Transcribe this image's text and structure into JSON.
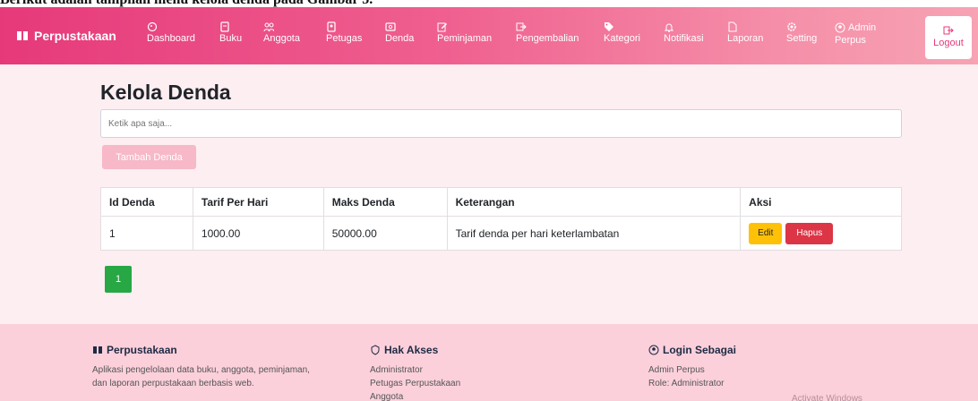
{
  "caption_fragment": "Berikut adalah tampilan menu kelola denda pada Gambar 5.",
  "brand": "Perpustakaan",
  "nav": [
    {
      "label": "Dashboard",
      "icon": "palette-icon"
    },
    {
      "label": "Buku",
      "icon": "book-icon"
    },
    {
      "label": "Anggota",
      "icon": "people-icon"
    },
    {
      "label": "Petugas",
      "icon": "person-badge-icon"
    },
    {
      "label": "Denda",
      "icon": "cash-icon"
    },
    {
      "label": "Peminjaman",
      "icon": "pencil-square-icon"
    },
    {
      "label": "Pengembalian",
      "icon": "box-arrow-right-icon"
    },
    {
      "label": "Kategori",
      "icon": "tag-icon"
    },
    {
      "label": "Notifikasi",
      "icon": "bell-icon"
    },
    {
      "label": "Laporan",
      "icon": "file-icon"
    },
    {
      "label": "Setting",
      "icon": "gear-icon"
    }
  ],
  "admin": {
    "line1": "Admin",
    "line2": "Perpus",
    "icon": "person-circle-icon"
  },
  "logout": "Logout",
  "page": {
    "title": "Kelola Denda",
    "search_placeholder": "Ketik apa saja...",
    "add_button": "Tambah Denda"
  },
  "table": {
    "headers": [
      "Id Denda",
      "Tarif Per Hari",
      "Maks Denda",
      "Keterangan",
      "Aksi"
    ],
    "rows": [
      {
        "id": "1",
        "tarif": "1000.00",
        "maks": "50000.00",
        "keterangan": "Tarif denda per hari keterlambatan",
        "edit": "Edit",
        "hapus": "Hapus"
      }
    ]
  },
  "pagination": {
    "current": "1"
  },
  "footer": {
    "about": {
      "title": "Perpustakaan",
      "text1": "Aplikasi pengelolaan data buku, anggota, peminjaman,",
      "text2": "dan laporan perpustakaan berbasis web."
    },
    "access": {
      "title": "Hak Akses",
      "items": [
        "Administrator",
        "Petugas Perpustakaan",
        "Anggota"
      ]
    },
    "login": {
      "title": "Login Sebagai",
      "user": "Admin Perpus",
      "role": "Role: Administrator"
    }
  },
  "watermark": "Activate Windows",
  "colors": {
    "primary": "#e6397a",
    "warning": "#ffc107",
    "danger": "#dc3545",
    "success": "#28a745",
    "bg": "#fdeef2",
    "footer": "#fbd0db"
  }
}
